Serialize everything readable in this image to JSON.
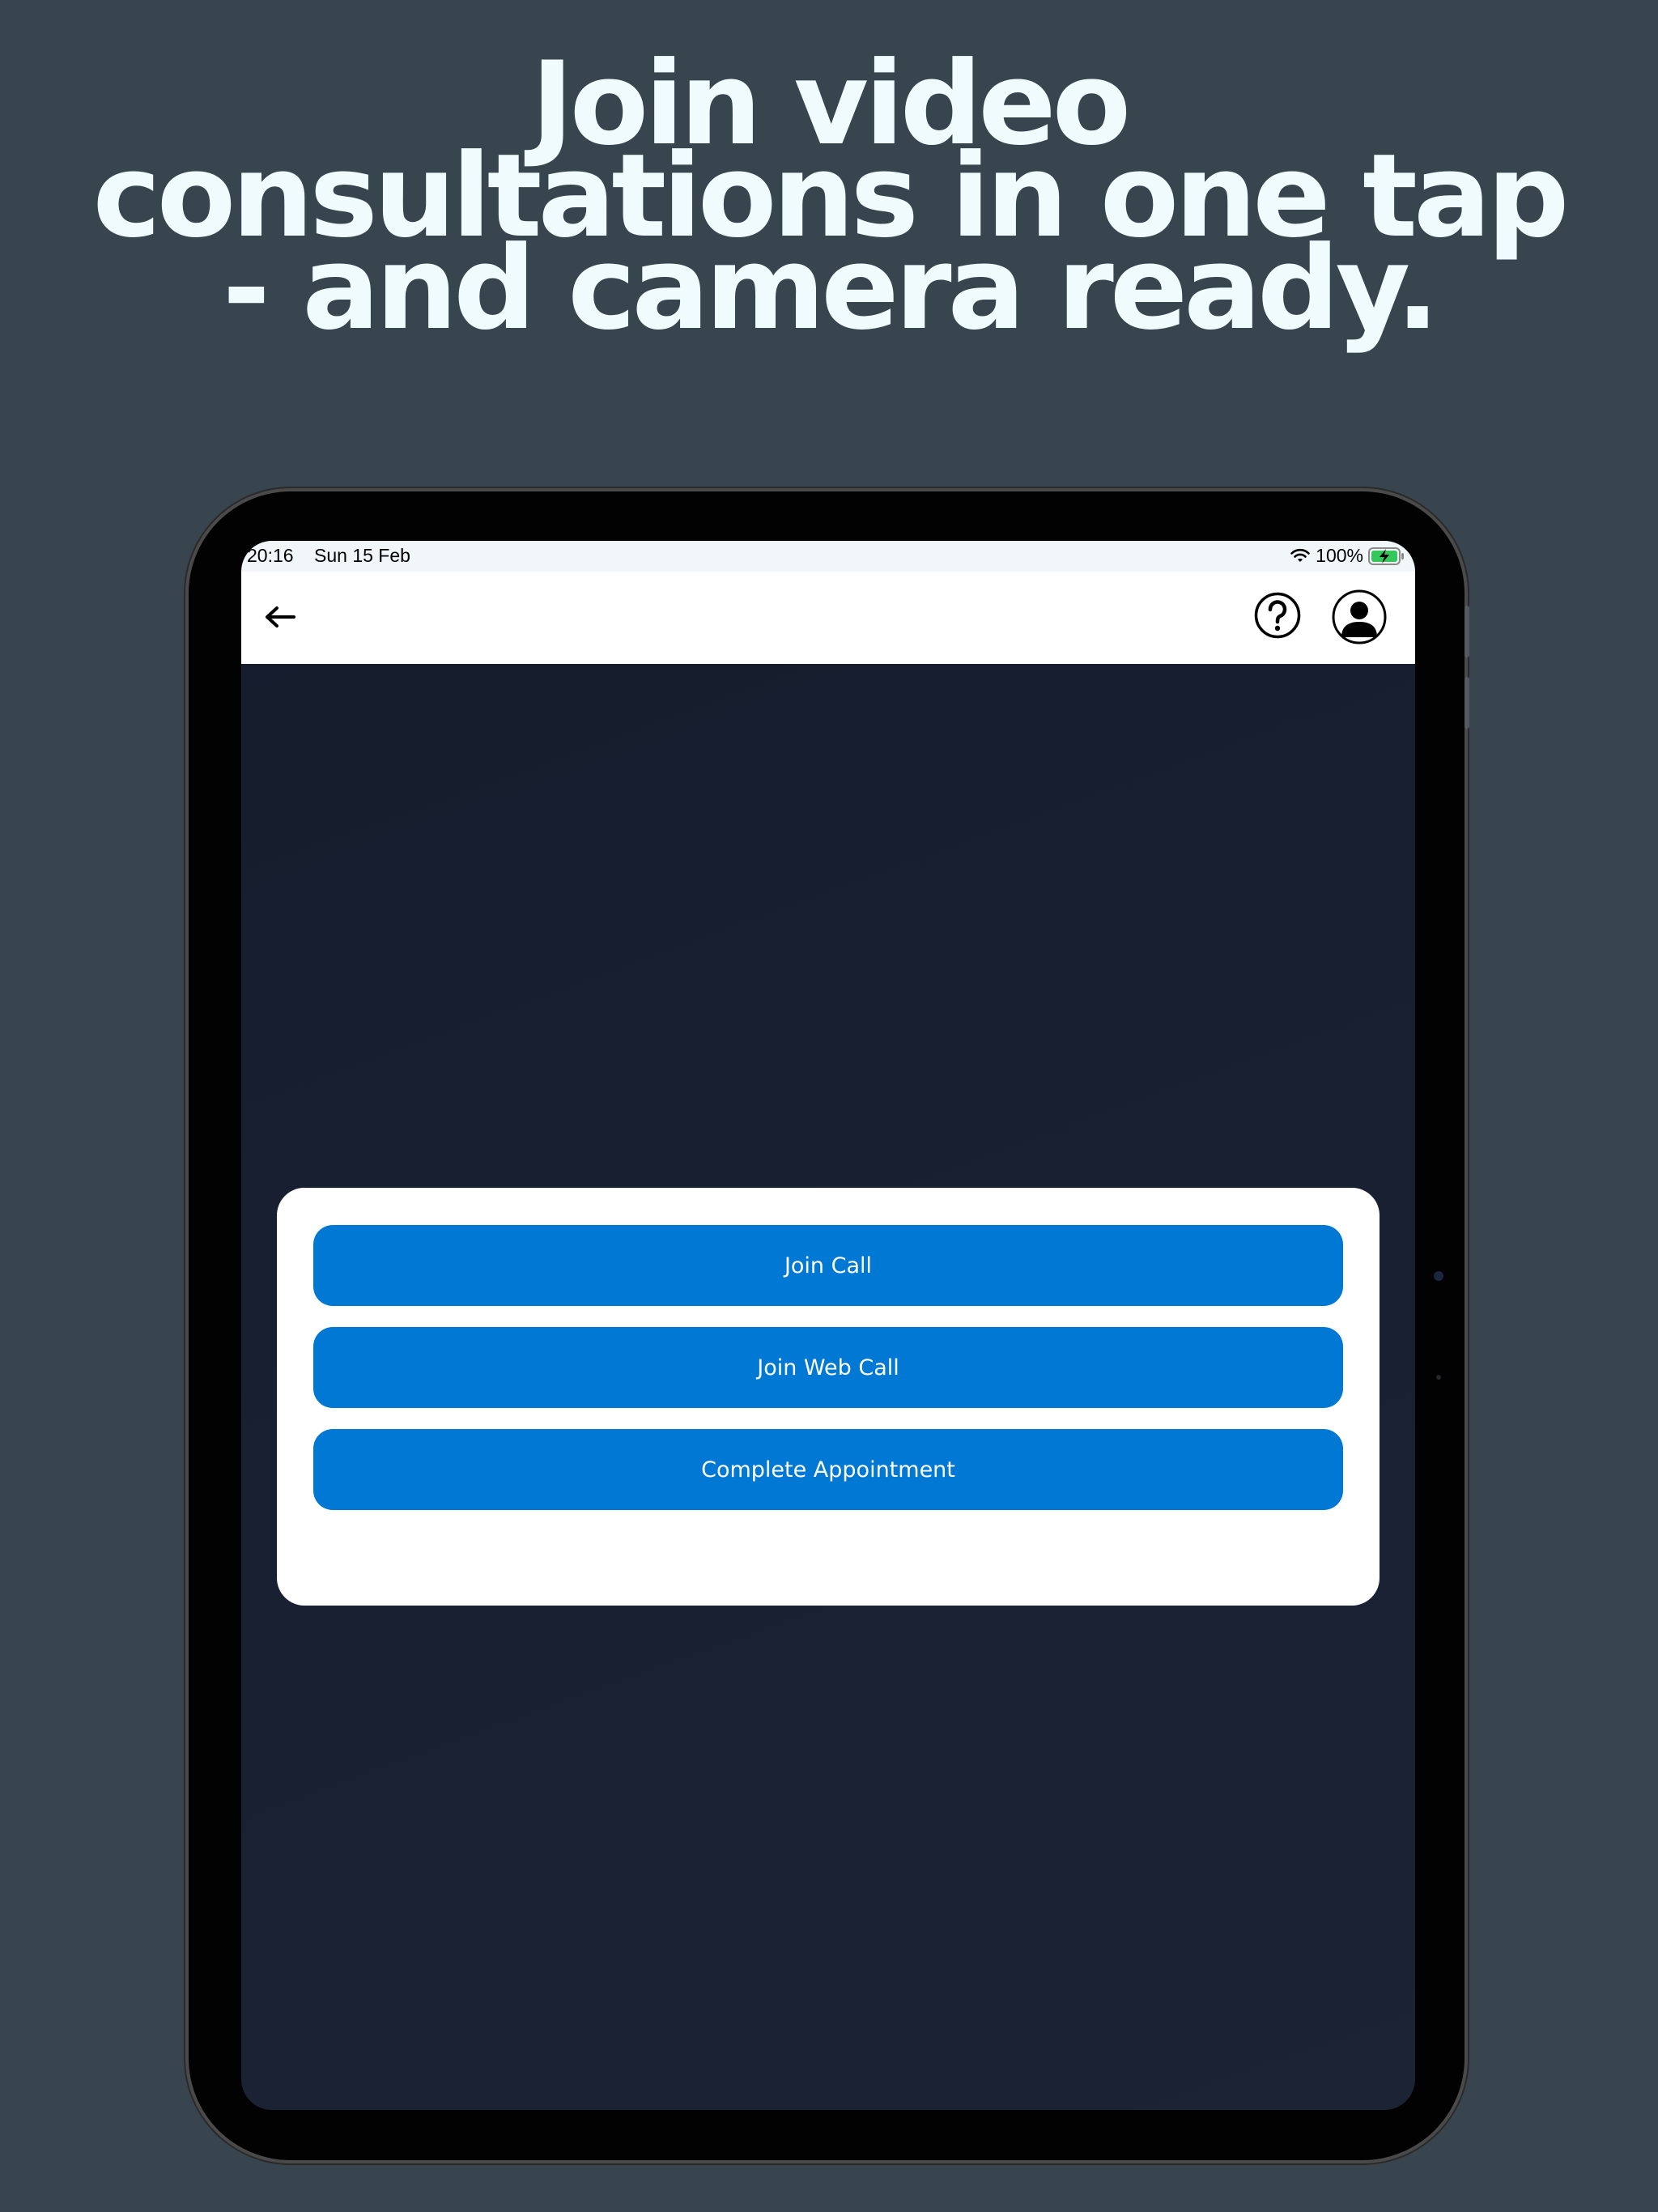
{
  "headline": {
    "line1": "Join video",
    "line2": "consultations in one tap",
    "line3": "- and camera ready."
  },
  "status_bar": {
    "time": "20:16",
    "date": "Sun 15 Feb",
    "battery_percent": "100%",
    "battery_level": 1.0,
    "charging": true
  },
  "nav": {
    "back_icon": "arrow-left-icon",
    "help_icon": "question-circle-icon",
    "profile_icon": "user-circle-icon"
  },
  "actions": {
    "join_call": "Join Call",
    "join_web_call": "Join Web Call",
    "complete_appointment": "Complete Appointment"
  },
  "colors": {
    "page_background": "#38454f",
    "headline_text": "#effbfc",
    "screen_background": "#182032",
    "button_primary": "#0078d4",
    "battery_fill": "#34c759"
  }
}
